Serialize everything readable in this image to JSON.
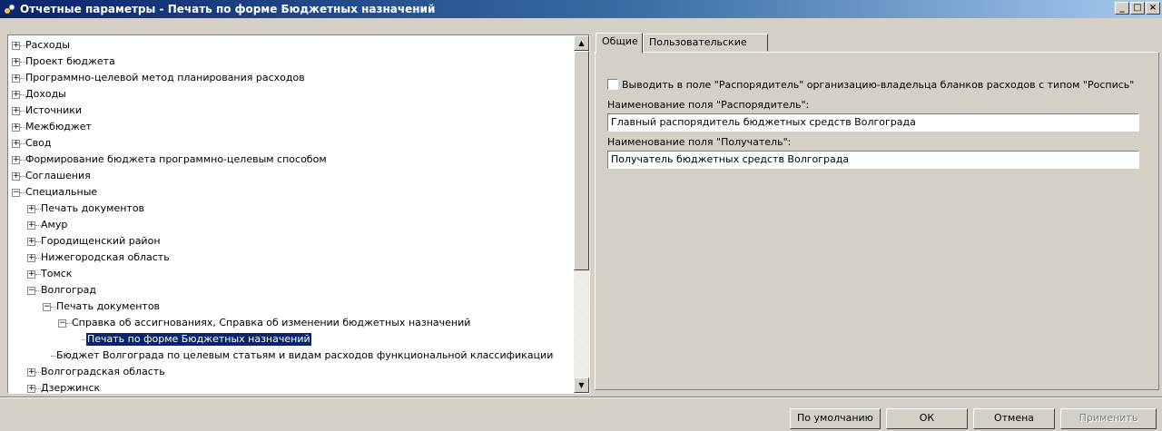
{
  "window": {
    "title": "Отчетные параметры - Печать по форме Бюджетных назначений",
    "min_glyph": "_",
    "max_glyph": "□",
    "close_glyph": "×"
  },
  "tree": {
    "items": [
      {
        "label": "Расходы",
        "expander": "+"
      },
      {
        "label": "Проект бюджета",
        "expander": "+"
      },
      {
        "label": "Программно-целевой метод планирования расходов",
        "expander": "+"
      },
      {
        "label": "Доходы",
        "expander": "+"
      },
      {
        "label": "Источники",
        "expander": "+"
      },
      {
        "label": "Межбюджет",
        "expander": "+"
      },
      {
        "label": "Свод",
        "expander": "+"
      },
      {
        "label": "Формирование бюджета программно-целевым способом",
        "expander": "+"
      },
      {
        "label": "Соглашения",
        "expander": "+"
      },
      {
        "label": "Специальные",
        "expander": "−"
      },
      {
        "label": "Печать документов",
        "expander": "+"
      },
      {
        "label": "Амур",
        "expander": "+"
      },
      {
        "label": "Городищенский район",
        "expander": "+"
      },
      {
        "label": "Нижегородская область",
        "expander": "+"
      },
      {
        "label": "Томск",
        "expander": "+"
      },
      {
        "label": "Волгоград",
        "expander": "−"
      },
      {
        "label": "Печать документов",
        "expander": "−"
      },
      {
        "label": "Справка об ассигнованиях, Справка об изменении бюджетных назначений",
        "expander": "−"
      },
      {
        "label": "Печать по форме Бюджетных назначений",
        "expander": "",
        "selected": true
      },
      {
        "label": "Бюджет Волгограда по целевым статьям и видам расходов функциональной классификации",
        "expander": ""
      },
      {
        "label": "Волгоградская область",
        "expander": "+"
      },
      {
        "label": "Дзержинск",
        "expander": "+"
      }
    ],
    "scroll_up_glyph": "▲",
    "scroll_down_glyph": "▼"
  },
  "tabs": [
    {
      "label": "Общие",
      "active": true
    },
    {
      "label": "Пользовательские",
      "active": false
    }
  ],
  "general": {
    "checkbox_label": "Выводить в поле \"Распорядитель\" организацию-владельца бланков расходов с типом \"Роспись\"",
    "checkbox_checked": false,
    "manager_label": "Наименование поля \"Распорядитель\":",
    "manager_value": "Главный распорядитель бюджетных средств Волгограда",
    "recipient_label": "Наименование поля \"Получатель\":",
    "recipient_value": "Получатель бюджетных средств Волгограда"
  },
  "buttons": {
    "default": "По умолчанию",
    "ok": "ОК",
    "cancel": "Отмена",
    "apply": "Применить"
  },
  "colors": {
    "selection": "#0a246a",
    "title_start": "#0a246a",
    "title_end": "#a6caf0",
    "face": "#d4d0c8"
  }
}
